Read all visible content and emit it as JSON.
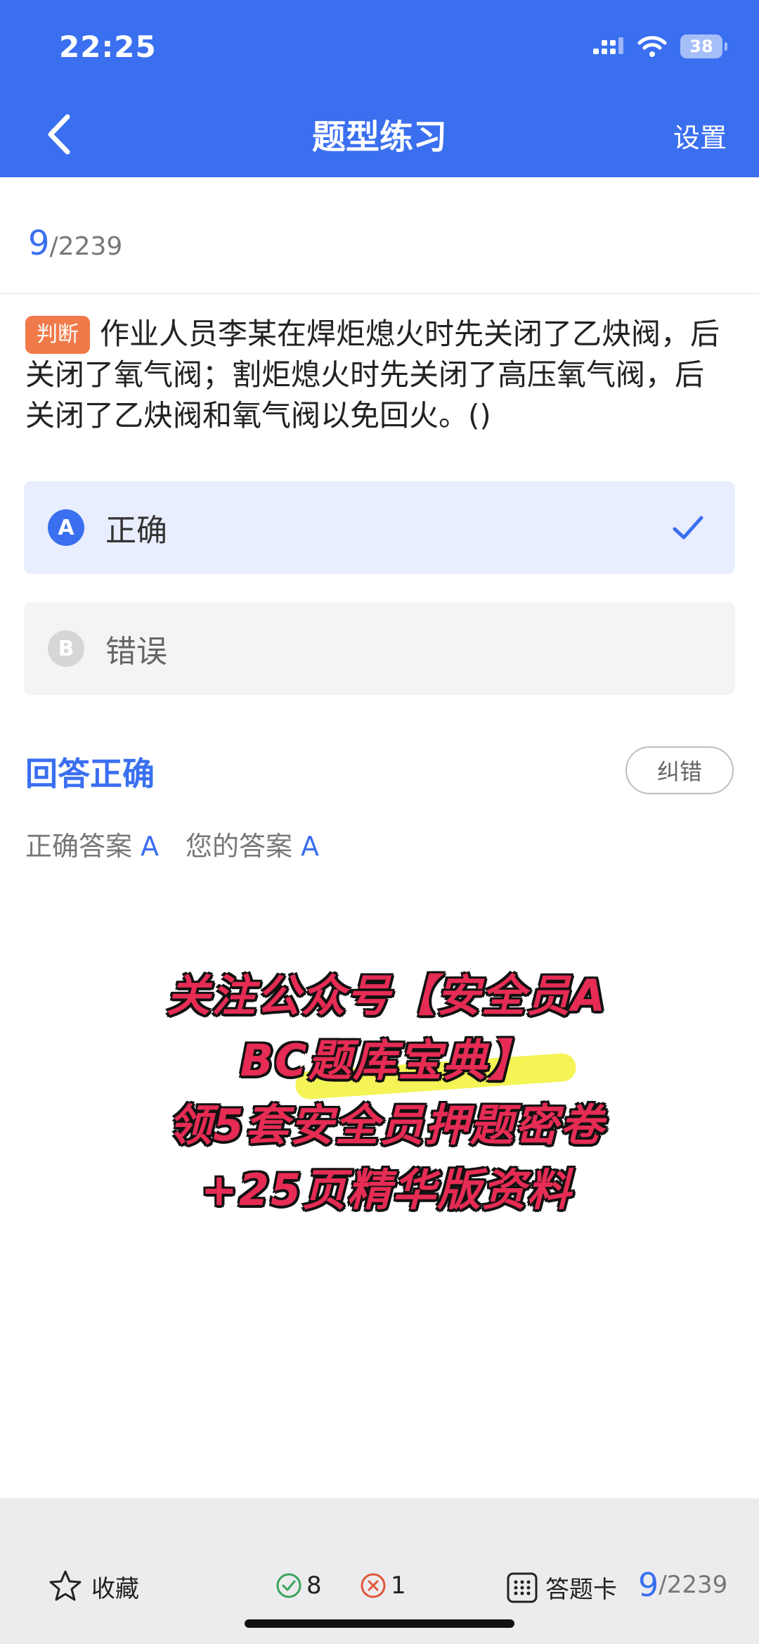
{
  "status_bar": {
    "time": "22:25",
    "battery": "38"
  },
  "nav": {
    "title": "题型练习",
    "settings_label": "设置"
  },
  "counter": {
    "current": "9",
    "total": "/2239"
  },
  "question": {
    "tag": "判断",
    "text": "作业人员李某在焊炬熄火时先关闭了乙炔阀，后关闭了氧气阀；割炬熄火时先关闭了高压氧气阀，后关闭了乙炔阀和氧气阀以免回火。()"
  },
  "options": [
    {
      "letter": "A",
      "text": "正确",
      "selected": true
    },
    {
      "letter": "B",
      "text": "错误",
      "selected": false
    }
  ],
  "result": {
    "status": "回答正确",
    "report_label": "纠错",
    "correct_label": "正确答案",
    "correct_value": "A",
    "yours_label": "您的答案",
    "yours_value": "A"
  },
  "promo": {
    "line1": "关注公众号【安全员A",
    "line2": "BC题库宝典】",
    "line3": "领5套安全员押题密卷",
    "line4": "+25页精华版资料"
  },
  "bottom_bar": {
    "favorite_label": "收藏",
    "correct_count": "8",
    "wrong_count": "1",
    "answer_card_label": "答题卡",
    "current": "9",
    "total": "/2239"
  },
  "colors": {
    "accent": "#3a6ff0",
    "tag": "#f07a49",
    "promo": "#e62c54"
  }
}
